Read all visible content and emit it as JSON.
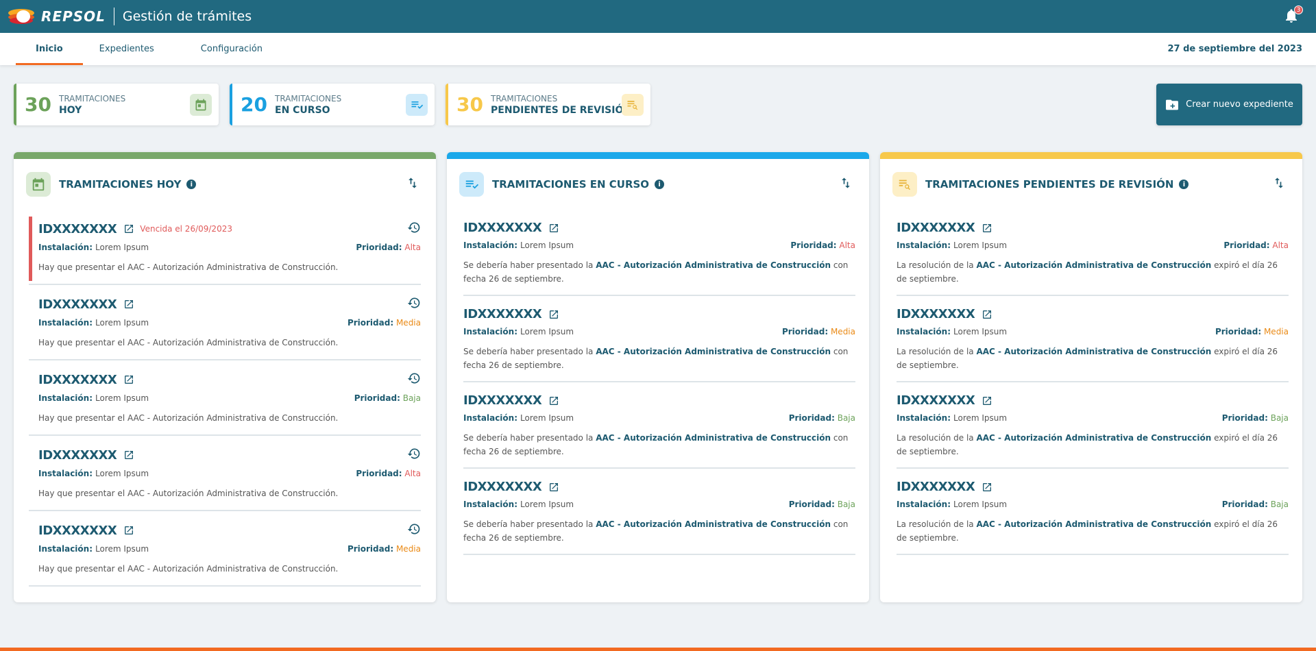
{
  "header": {
    "brand": "REPSOL",
    "title": "Gestión de trámites",
    "notifications": "3"
  },
  "nav": {
    "tabs": [
      "Inicio",
      "Expedientes",
      "Configuración"
    ],
    "date": "27 de septiembre del 2023"
  },
  "stats": [
    {
      "num": "30",
      "l1": "TRAMITACIONES",
      "l2": "HOY",
      "color": "#6ca25a"
    },
    {
      "num": "20",
      "l1": "TRAMITACIONES",
      "l2": "EN CURSO",
      "color": "#1aa0e0"
    },
    {
      "num": "30",
      "l1": "TRAMITACIONES",
      "l2": "PENDIENTES DE REVISIÓN",
      "color": "#f7c84a"
    }
  ],
  "create_button": "Crear nuevo expediente",
  "panels": {
    "hoy": {
      "title": "TRAMITACIONES HOY",
      "items": [
        {
          "id": "IDXXXXXXX",
          "overdue": "Vencida el 26/09/2023",
          "inst_label": "Instalación:",
          "inst": "Lorem Ipsum",
          "prio_label": "Prioridad:",
          "prio": "Alta",
          "desc": "Hay que presentar el AAC - Autorización Administrativa de Construcción."
        },
        {
          "id": "IDXXXXXXX",
          "inst_label": "Instalación:",
          "inst": "Lorem Ipsum",
          "prio_label": "Prioridad:",
          "prio": "Media",
          "desc": "Hay que presentar el AAC - Autorización Administrativa de Construcción."
        },
        {
          "id": "IDXXXXXXX",
          "inst_label": "Instalación:",
          "inst": "Lorem Ipsum",
          "prio_label": "Prioridad:",
          "prio": "Baja",
          "desc": "Hay que presentar el AAC - Autorización Administrativa de Construcción."
        },
        {
          "id": "IDXXXXXXX",
          "inst_label": "Instalación:",
          "inst": "Lorem Ipsum",
          "prio_label": "Prioridad:",
          "prio": "Alta",
          "desc": "Hay que presentar el AAC - Autorización Administrativa de Construcción."
        },
        {
          "id": "IDXXXXXXX",
          "inst_label": "Instalación:",
          "inst": "Lorem Ipsum",
          "prio_label": "Prioridad:",
          "prio": "Media",
          "desc": "Hay que presentar el AAC - Autorización Administrativa de Construcción."
        }
      ]
    },
    "curso": {
      "title": "TRAMITACIONES EN CURSO",
      "desc_pre": "Se debería haber presentado la",
      "desc_bold": "AAC - Autorización Administrativa de Construcción",
      "desc_post": "con fecha 26 de septiembre.",
      "items": [
        {
          "id": "IDXXXXXXX",
          "inst_label": "Instalación:",
          "inst": "Lorem Ipsum",
          "prio_label": "Prioridad:",
          "prio": "Alta"
        },
        {
          "id": "IDXXXXXXX",
          "inst_label": "Instalación:",
          "inst": "Lorem Ipsum",
          "prio_label": "Prioridad:",
          "prio": "Media"
        },
        {
          "id": "IDXXXXXXX",
          "inst_label": "Instalación:",
          "inst": "Lorem Ipsum",
          "prio_label": "Prioridad:",
          "prio": "Baja"
        },
        {
          "id": "IDXXXXXXX",
          "inst_label": "Instalación:",
          "inst": "Lorem Ipsum",
          "prio_label": "Prioridad:",
          "prio": "Baja"
        }
      ]
    },
    "rev": {
      "title": "TRAMITACIONES PENDIENTES DE REVISIÓN",
      "desc_pre": "La resolución de la",
      "desc_bold": "AAC - Autorización Administrativa de Construcción",
      "desc_post": "expiró el día 26 de septiembre.",
      "items": [
        {
          "id": "IDXXXXXXX",
          "inst_label": "Instalación:",
          "inst": "Lorem Ipsum",
          "prio_label": "Prioridad:",
          "prio": "Alta"
        },
        {
          "id": "IDXXXXXXX",
          "inst_label": "Instalación:",
          "inst": "Lorem Ipsum",
          "prio_label": "Prioridad:",
          "prio": "Media"
        },
        {
          "id": "IDXXXXXXX",
          "inst_label": "Instalación:",
          "inst": "Lorem Ipsum",
          "prio_label": "Prioridad:",
          "prio": "Baja"
        },
        {
          "id": "IDXXXXXXX",
          "inst_label": "Instalación:",
          "inst": "Lorem Ipsum",
          "prio_label": "Prioridad:",
          "prio": "Baja"
        }
      ]
    }
  }
}
